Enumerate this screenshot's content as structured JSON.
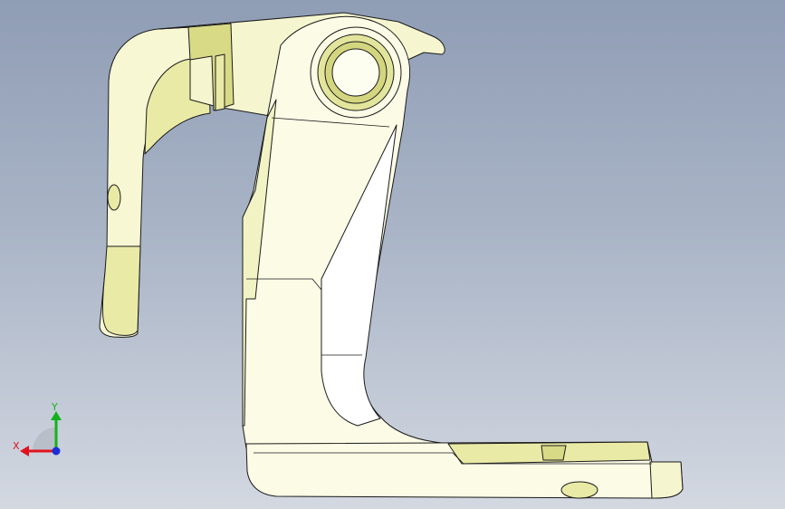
{
  "viewport": {
    "background_top": "#8f9db5",
    "background_bottom": "#d3d8e1"
  },
  "part": {
    "fill": "#fbfbe6",
    "shade": "#e9eaa6",
    "deep_shade": "#d8da86",
    "edge": "#1b1b1b"
  },
  "triad": {
    "x_label": "X",
    "y_label": "Y",
    "x_color": "#e0141e",
    "y_color": "#12b21a",
    "z_color": "#1c2fd8"
  }
}
